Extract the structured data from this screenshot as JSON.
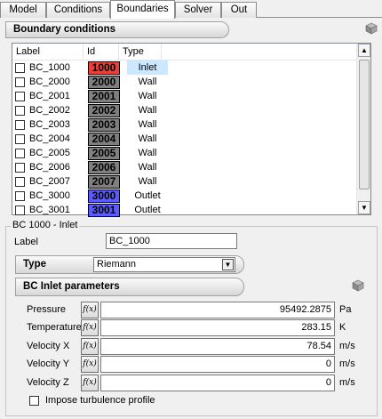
{
  "tabs": [
    "Model",
    "Conditions",
    "Boundaries",
    "Solver",
    "Out"
  ],
  "active_tab": "Boundaries",
  "boundary_section": {
    "title": "Boundary conditions"
  },
  "table": {
    "columns": [
      "Label",
      "Id",
      "Type"
    ],
    "rows": [
      {
        "label": "BC_1000",
        "id": "1000",
        "type": "Inlet",
        "color": "#e8413a",
        "selected": true
      },
      {
        "label": "BC_2000",
        "id": "2000",
        "type": "Wall",
        "color": "#7f7f7f"
      },
      {
        "label": "BC_2001",
        "id": "2001",
        "type": "Wall",
        "color": "#7f7f7f"
      },
      {
        "label": "BC_2002",
        "id": "2002",
        "type": "Wall",
        "color": "#7f7f7f"
      },
      {
        "label": "BC_2003",
        "id": "2003",
        "type": "Wall",
        "color": "#7f7f7f"
      },
      {
        "label": "BC_2004",
        "id": "2004",
        "type": "Wall",
        "color": "#7f7f7f"
      },
      {
        "label": "BC_2005",
        "id": "2005",
        "type": "Wall",
        "color": "#7f7f7f"
      },
      {
        "label": "BC_2006",
        "id": "2006",
        "type": "Wall",
        "color": "#7f7f7f"
      },
      {
        "label": "BC_2007",
        "id": "2007",
        "type": "Wall",
        "color": "#7f7f7f"
      },
      {
        "label": "BC_3000",
        "id": "3000",
        "type": "Outlet",
        "color": "#5b5bff"
      },
      {
        "label": "BC_3001",
        "id": "3001",
        "type": "Outlet",
        "color": "#5b5bff"
      }
    ]
  },
  "bc_detail": {
    "caption": "BC 1000 -  Inlet",
    "label_field": {
      "label": "Label",
      "value": "BC_1000"
    },
    "type_bar": {
      "label": "Type",
      "value": "Riemann"
    }
  },
  "inlet_section": {
    "title": "BC Inlet parameters"
  },
  "fx_label": "f(x)",
  "parameters": [
    {
      "label": "Pressure",
      "value": "95492.2875",
      "unit": "Pa"
    },
    {
      "label": "Temperature",
      "value": "283.15",
      "unit": "K"
    },
    {
      "label": "Velocity X",
      "value": "78.54",
      "unit": "m/s"
    },
    {
      "label": "Velocity Y",
      "value": "0",
      "unit": "m/s"
    },
    {
      "label": "Velocity Z",
      "value": "0",
      "unit": "m/s"
    }
  ],
  "turbulence_checkbox": {
    "label": "Impose turbulence profile",
    "checked": false
  },
  "colors": {
    "inlet": "#e8413a",
    "wall": "#7f7f7f",
    "outlet": "#5b5bff",
    "selection": "#cce8ff"
  }
}
